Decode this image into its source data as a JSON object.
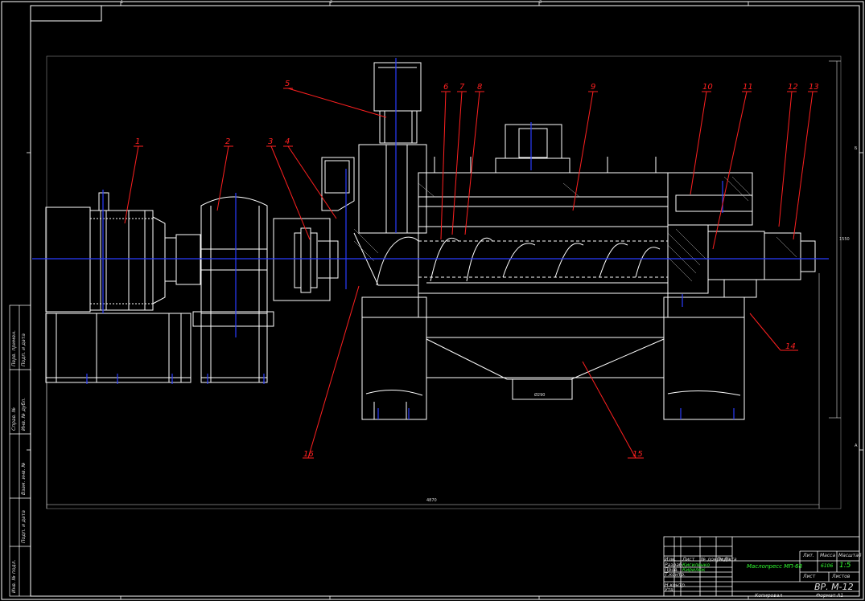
{
  "drawing": {
    "callouts": [
      "1",
      "2",
      "3",
      "4",
      "5",
      "6",
      "7",
      "8",
      "9",
      "10",
      "11",
      "12",
      "13",
      "14",
      "15",
      "16"
    ],
    "dimensions": {
      "overall_length": "4870",
      "outlet_width": "Ø290",
      "height": "1550"
    },
    "zone_marks": [
      "1",
      "2",
      "3",
      "4",
      "5",
      "6",
      "А",
      "Б"
    ]
  },
  "title_block": {
    "product_name": "Маслопресс МП-68",
    "letter": "",
    "mass_label": "Масса",
    "mass_value": "6106",
    "scale_label": "Масштаб",
    "scale_value": "1:5",
    "sheet_label": "Лист",
    "sheets_label": "Листов",
    "drawing_no": "ВР. М-12",
    "designer_label": "Разраб.",
    "designer_name": "Кисиленко",
    "checker_label": "Пров.",
    "checker_name": "Кирилюк",
    "tcontrol_label": "Т.контр.",
    "ncontrol_label": "Н.контр.",
    "approved_label": "Утв.",
    "col_labels": [
      "Изм.",
      "Лист",
      "№ докум.",
      "Подп.",
      "Дата"
    ],
    "lit_label": "Лит.",
    "copied": "Копировал",
    "format": "Формат А1"
  },
  "side_strip": [
    "Инв. № подл.",
    "Подп. и дата",
    "Взам. инв. №",
    "Инв. № дубл.",
    "Подп. и дата",
    "Перв. примен.",
    "Справ. №"
  ],
  "colors": {
    "bg": "#000000",
    "line": "#ffffff",
    "axis": "#2a3cff",
    "callout": "#ff2020",
    "text_green": "#31ff31",
    "hatch": "#bbbbbb"
  }
}
